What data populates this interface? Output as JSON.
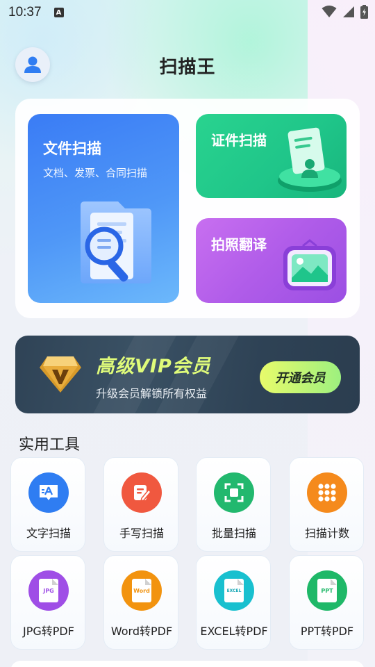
{
  "status": {
    "time": "10:37",
    "notification_letter": "A"
  },
  "header": {
    "title": "扫描王",
    "avatar_icon": "user-icon"
  },
  "scan_cards": {
    "document": {
      "title": "文件扫描",
      "subtitle": "文档、发票、合同扫描",
      "color": "#3a7cf5"
    },
    "id": {
      "title": "证件扫描",
      "color": "#29d38f"
    },
    "photo": {
      "title": "拍照翻译",
      "color": "#b05ce9"
    }
  },
  "vip": {
    "title": "高级VIP会员",
    "subtitle": "升级会员解锁所有权益",
    "button": "开通会员"
  },
  "tools": {
    "section_title": "实用工具",
    "items": [
      {
        "label": "文字扫描",
        "icon": "text-scan-icon",
        "color": "#2f7df2"
      },
      {
        "label": "手写扫描",
        "icon": "handwriting-icon",
        "color": "#f0583f"
      },
      {
        "label": "批量扫描",
        "icon": "batch-scan-icon",
        "color": "#22b86e"
      },
      {
        "label": "扫描计数",
        "icon": "count-grid-icon",
        "color": "#f58a1c"
      },
      {
        "label": "JPG转PDF",
        "icon": "jpg-file-icon",
        "file_text": "JPG",
        "color": "#9f4ee6"
      },
      {
        "label": "Word转PDF",
        "icon": "word-file-icon",
        "file_text": "Word",
        "color": "#f2930f"
      },
      {
        "label": "EXCEL转PDF",
        "icon": "excel-file-icon",
        "file_text": "EXCEL",
        "color": "#19c0cf"
      },
      {
        "label": "PPT转PDF",
        "icon": "ppt-file-icon",
        "file_text": "PPT",
        "color": "#1fb868"
      }
    ]
  }
}
